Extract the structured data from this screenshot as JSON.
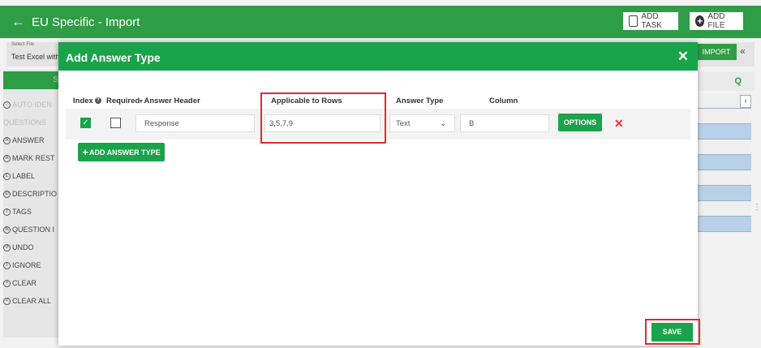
{
  "app": {
    "title": "EU Specific - Import",
    "add_task_label": "ADD TASK",
    "add_file_label": "ADD FILE",
    "select_file_label": "Select File",
    "select_file_value": "Test Excel with",
    "import_label": "IMPORT"
  },
  "left_panel": {
    "head_label": "S",
    "items": [
      {
        "icon": "a",
        "label": "AUTO IDEN",
        "dim": true
      },
      {
        "icon": "",
        "label": "QUESTIONS",
        "dim": true
      },
      {
        "icon": "A",
        "label": "ANSWER"
      },
      {
        "icon": "A",
        "label": "MARK REST"
      },
      {
        "icon": "L",
        "label": "LABEL"
      },
      {
        "icon": "D",
        "label": "DESCRIPTIO"
      },
      {
        "icon": "T",
        "label": "TAGS"
      },
      {
        "icon": "N",
        "label": "QUESTION I"
      },
      {
        "icon": "↺",
        "label": "UNDO"
      },
      {
        "icon": "I",
        "label": "IGNORE"
      },
      {
        "icon": "×",
        "label": "CLEAR"
      },
      {
        "icon": "×",
        "label": "CLEAR ALL"
      }
    ]
  },
  "modal": {
    "title": "Add Answer Type",
    "columns": {
      "index": "Index",
      "required": "Required",
      "answer_header": "Answer Header",
      "applicable_rows": "Applicable to Rows",
      "answer_type": "Answer Type",
      "column": "Column"
    },
    "row": {
      "index_checked": true,
      "required_checked": false,
      "answer_header": "Response",
      "applicable_rows": "3,5,7,9",
      "answer_type": "Text",
      "column": "B",
      "options_label": "OPTIONS"
    },
    "add_label": "ADD ANSWER TYPE",
    "save_label": "SAVE"
  },
  "colors": {
    "brand_green": "#1aa34a",
    "header_green": "#2e9d46",
    "highlight_red": "#e02b2b"
  }
}
